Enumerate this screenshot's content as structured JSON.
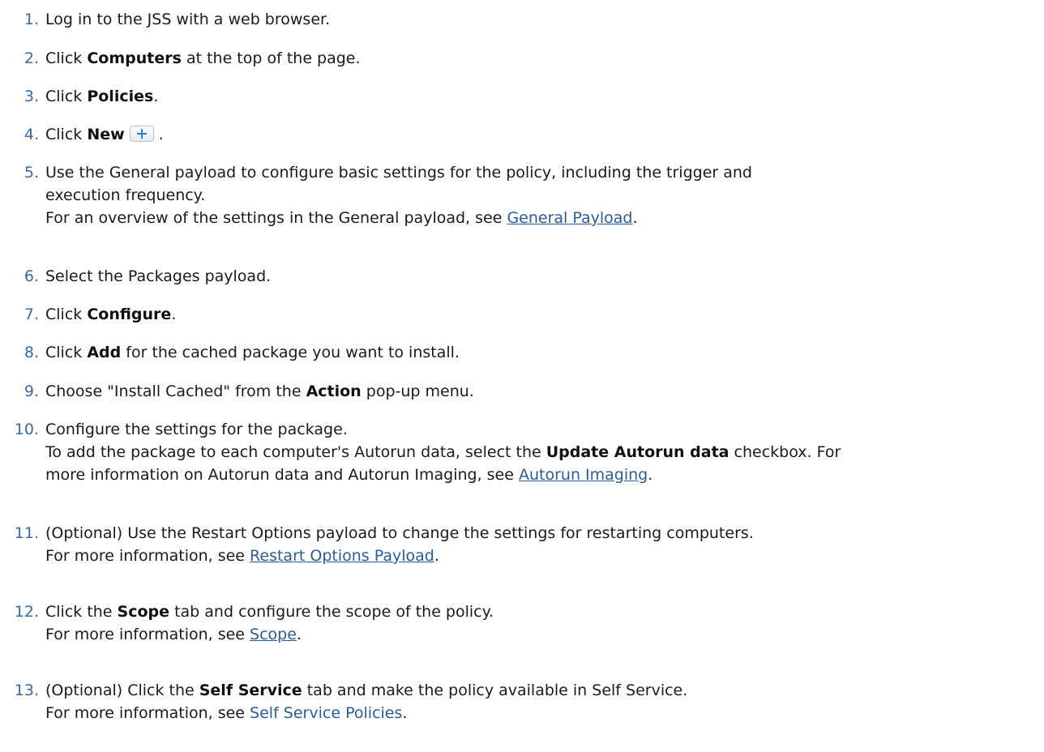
{
  "steps": [
    {
      "num": "1.",
      "text": "Log in to the JSS with a web browser."
    },
    {
      "num": "2.",
      "pre": "Click ",
      "bold": "Computers",
      "post": " at the top of the page."
    },
    {
      "num": "3.",
      "pre": "Click ",
      "bold": "Policies",
      "post": "."
    },
    {
      "num": "4.",
      "pre": "Click ",
      "bold": "New",
      "post": " ."
    },
    {
      "num": "5.",
      "line1": "Use the General payload to configure basic settings for the policy, including the trigger and",
      "line2": "execution frequency.",
      "note_pre": "For an overview of the settings in the General payload, see ",
      "link": "General Payload",
      "note_post": "."
    },
    {
      "num": "6.",
      "text": "Select the Packages payload."
    },
    {
      "num": "7.",
      "pre": "Click ",
      "bold": "Configure",
      "post": "."
    },
    {
      "num": "8.",
      "pre": "Click ",
      "bold": "Add",
      "post": " for the cached package you want to install."
    },
    {
      "num": "9.",
      "pre": "Choose \"Install Cached\" from the ",
      "bold": "Action",
      "post": " pop-up menu."
    },
    {
      "num": "10.",
      "text": "Configure the settings for the package.",
      "note_pre": "To add the package to each computer's Autorun data, select the ",
      "note_bold": "Update Autorun data",
      "note_post": " checkbox. For",
      "note2_pre": "more information on Autorun data and Autorun Imaging, see ",
      "link": "Autorun Imaging",
      "note2_post": "."
    },
    {
      "num": "11.",
      "text": "(Optional) Use the Restart Options payload to change the settings for restarting computers.",
      "note_pre": "For more information, see ",
      "link": "Restart Options Payload",
      "note_post": "."
    },
    {
      "num": "12.",
      "pre": "Click the ",
      "bold": "Scope",
      "post": " tab and configure the scope of the policy.",
      "note_pre": "For more information, see ",
      "link": "Scope",
      "note_post": "."
    },
    {
      "num": "13.",
      "pre": "(Optional) Click the ",
      "bold": "Self Service",
      "post": " tab and make the policy available in Self Service.",
      "note_pre": "For more information, see ",
      "link": "Self Service Policies",
      "note_post": "."
    }
  ]
}
